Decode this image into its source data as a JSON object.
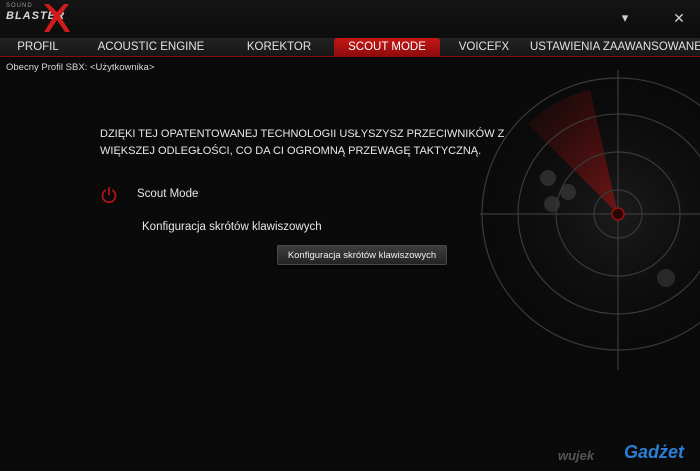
{
  "app": {
    "logo_small": "SOUND",
    "logo_main": "BLASTER"
  },
  "window": {
    "minimize_glyph": "▾",
    "close_glyph": "✕"
  },
  "tabs": [
    {
      "label": "PROFIL",
      "active": false
    },
    {
      "label": "ACOUSTIC ENGINE",
      "active": false
    },
    {
      "label": "KOREKTOR",
      "active": false
    },
    {
      "label": "SCOUT MODE",
      "active": true
    },
    {
      "label": "VOICEFX",
      "active": false
    },
    {
      "label": "USTAWIENIA ZAAWANSOWANE",
      "active": false
    }
  ],
  "profile": {
    "text": "Obecny Profil SBX: <Użytkownika>"
  },
  "main": {
    "description": "DZIĘKI TEJ OPATENTOWANEJ TECHNOLOGII USŁYSZYSZ PRZECIWNIKÓW Z WIĘKSZEJ ODLEGŁOŚCI, CO DA CI OGROMNĄ PRZEWAGĘ TAKTYCZNĄ.",
    "scout_mode_label": "Scout Mode",
    "scout_mode_enabled": false,
    "power_icon": "power-icon",
    "shortcut_label": "Konfiguracja skrótów klawiszowych",
    "shortcut_button_label": "Konfiguracja skrótów klawiszowych"
  },
  "watermark": {
    "text": "wujek",
    "badge": "Gadżet"
  },
  "colors": {
    "accent": "#c41616",
    "power_icon": "#b01414",
    "background": "#0a0a0a"
  }
}
